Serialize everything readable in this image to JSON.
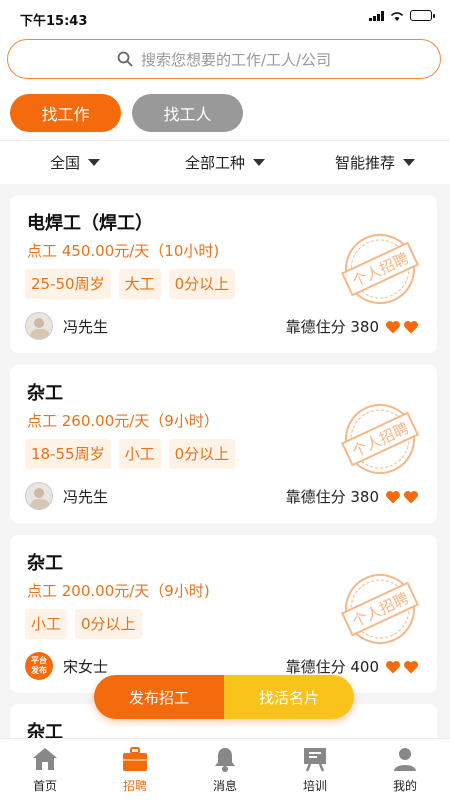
{
  "status": {
    "time": "下午15:43"
  },
  "search": {
    "placeholder": "搜索您想要的工作/工人/公司",
    "icon": "search-icon"
  },
  "mode_tabs": [
    {
      "label": "找工作",
      "active": true
    },
    {
      "label": "找工人",
      "active": false
    }
  ],
  "filters": [
    {
      "label": "全国"
    },
    {
      "label": "全部工种"
    },
    {
      "label": "智能推荐"
    }
  ],
  "jobs": [
    {
      "title": "电焊工（焊工）",
      "wage": "点工 450.00元/天（10小时)",
      "tags": [
        "25-50周岁",
        "大工",
        "0分以上"
      ],
      "poster": "冯先生",
      "poster_type": "avatar",
      "score_label": "靠德住分 380",
      "stamp": "个人招聘"
    },
    {
      "title": "杂工",
      "wage": "点工 260.00元/天（9小时）",
      "tags": [
        "18-55周岁",
        "小工",
        "0分以上"
      ],
      "poster": "冯先生",
      "poster_type": "avatar",
      "score_label": "靠德住分 380",
      "stamp": "个人招聘"
    },
    {
      "title": "杂工",
      "wage": "点工 200.00元/天（9小时)",
      "tags": [
        "小工",
        "0分以上"
      ],
      "poster": "宋女士",
      "poster_type": "platform",
      "platform_badge": "平台发布",
      "score_label": "靠德住分 400",
      "stamp": "个人招聘"
    }
  ],
  "partial_job": {
    "title": "杂工"
  },
  "fab": {
    "left": "发布招工",
    "right": "找活名片"
  },
  "tabbar": [
    {
      "label": "首页",
      "icon": "home-icon",
      "active": false
    },
    {
      "label": "招聘",
      "icon": "briefcase-icon",
      "active": true
    },
    {
      "label": "消息",
      "icon": "bell-icon",
      "active": false
    },
    {
      "label": "培训",
      "icon": "training-icon",
      "active": false
    },
    {
      "label": "我的",
      "icon": "user-icon",
      "active": false
    }
  ],
  "colors": {
    "accent": "#f46b0e",
    "accent_light": "#fff2e6",
    "secondary": "#f9c31c",
    "inactive": "#999999"
  }
}
